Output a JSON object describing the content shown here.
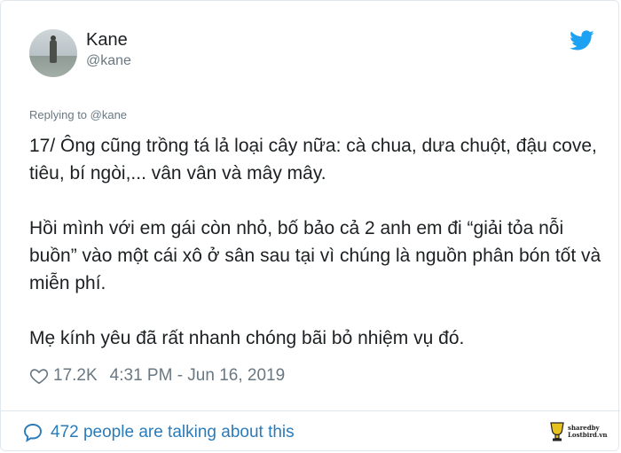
{
  "tweet": {
    "display_name": "Kane",
    "handle": "@kane",
    "replying_to": "Replying to @kane",
    "paragraphs": [
      "17/ Ông cũng trồng tá lả loại cây nữa: cà chua, dưa chuột, đậu cove, tiêu, bí ngòi,... vân vân và mây mây.",
      "Hồi mình với em gái còn nhỏ, bố bảo cả 2 anh em đi “giải tỏa nỗi buồn” vào một cái xô ở sân sau tại vì chúng là nguồn phân bón tốt và miễn phí.",
      "Mẹ kính yêu đã rất nhanh chóng bãi bỏ nhiệm vụ đó."
    ],
    "likes": "17.2K",
    "timestamp": "4:31 PM - Jun 16, 2019",
    "talking": "472 people are talking about this"
  },
  "watermark": {
    "line1": "sharedby",
    "line2": "Lostbird.vn"
  },
  "colors": {
    "link_blue": "#2b7bb9",
    "twitter_blue": "#1da1f2",
    "muted": "#697882"
  },
  "icons": {
    "brand": "twitter-bird-icon",
    "like": "heart-icon",
    "reply": "speech-bubble-icon"
  }
}
